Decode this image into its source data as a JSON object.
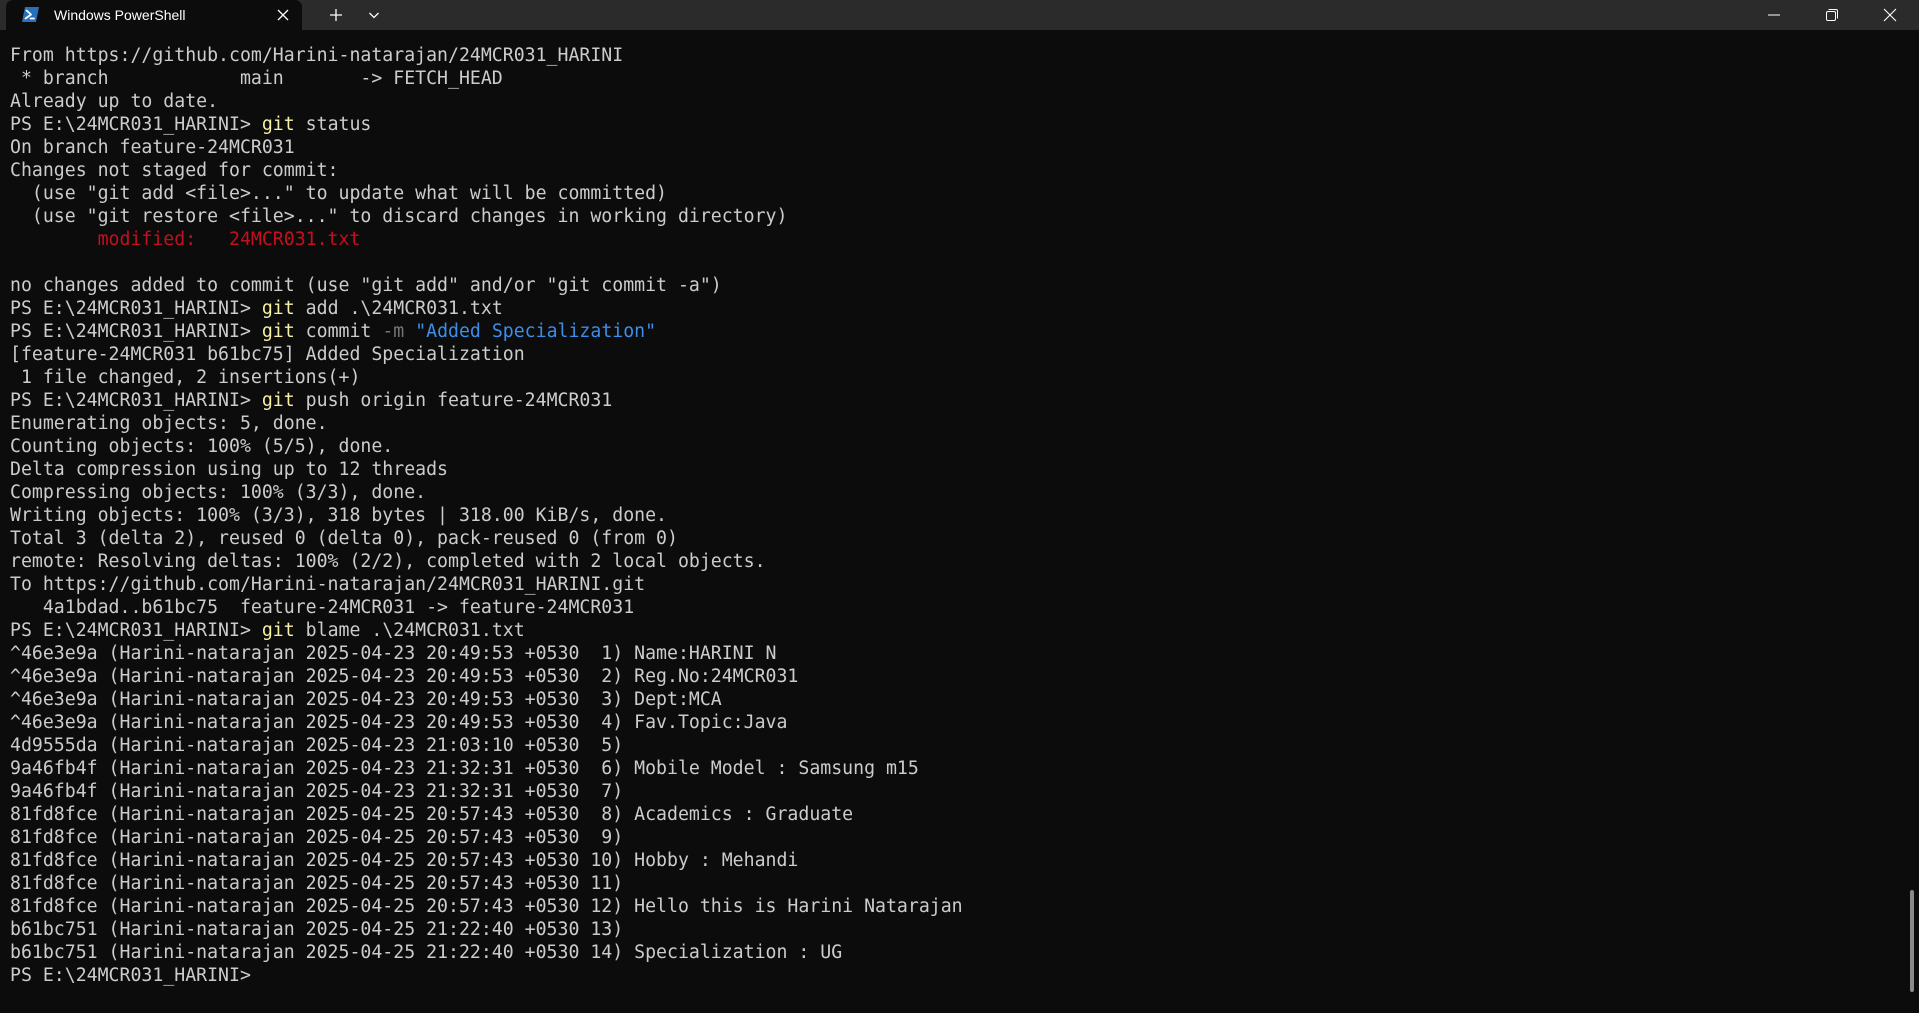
{
  "titlebar": {
    "tab_title": "Windows PowerShell",
    "tab_icon": "powershell-icon",
    "close_tab_icon": "close-icon",
    "new_tab_icon": "plus-icon",
    "dropdown_icon": "chevron-down-icon",
    "window_controls": [
      "minimize-icon",
      "restore-icon",
      "close-icon"
    ]
  },
  "colors": {
    "background": "#0c0c0c",
    "titlebar": "#2b2b2b",
    "text": "#cccccc",
    "command": "#f9f1a5",
    "parameter": "#767676",
    "string": "#3b8eea",
    "modified": "#c50f1f"
  },
  "terminal": {
    "lines": [
      [
        {
          "t": "From https://github.com/Harini-natarajan/24MCR031_HARINI"
        }
      ],
      [
        {
          "t": " * branch            main       -> FETCH_HEAD"
        }
      ],
      [
        {
          "t": "Already up to date."
        }
      ],
      [
        {
          "t": "PS E:\\24MCR031_HARINI> "
        },
        {
          "t": "git",
          "c": "cmd"
        },
        {
          "t": " status"
        }
      ],
      [
        {
          "t": "On branch feature-24MCR031"
        }
      ],
      [
        {
          "t": "Changes not staged for commit:"
        }
      ],
      [
        {
          "t": "  (use \"git add <file>...\" to update what will be committed)"
        }
      ],
      [
        {
          "t": "  (use \"git restore <file>...\" to discard changes in working directory)"
        }
      ],
      [
        {
          "t": "        modified:   24MCR031.txt",
          "c": "err"
        }
      ],
      [
        {
          "t": ""
        }
      ],
      [
        {
          "t": "no changes added to commit (use \"git add\" and/or \"git commit -a\")"
        }
      ],
      [
        {
          "t": "PS E:\\24MCR031_HARINI> "
        },
        {
          "t": "git",
          "c": "cmd"
        },
        {
          "t": " add .\\24MCR031.txt"
        }
      ],
      [
        {
          "t": "PS E:\\24MCR031_HARINI> "
        },
        {
          "t": "git",
          "c": "cmd"
        },
        {
          "t": " commit "
        },
        {
          "t": "-m",
          "c": "param"
        },
        {
          "t": " "
        },
        {
          "t": "\"Added Specialization\"",
          "c": "str"
        }
      ],
      [
        {
          "t": "[feature-24MCR031 b61bc75] Added Specialization"
        }
      ],
      [
        {
          "t": " 1 file changed, 2 insertions(+)"
        }
      ],
      [
        {
          "t": "PS E:\\24MCR031_HARINI> "
        },
        {
          "t": "git",
          "c": "cmd"
        },
        {
          "t": " push origin feature-24MCR031"
        }
      ],
      [
        {
          "t": "Enumerating objects: 5, done."
        }
      ],
      [
        {
          "t": "Counting objects: 100% (5/5), done."
        }
      ],
      [
        {
          "t": "Delta compression using up to 12 threads"
        }
      ],
      [
        {
          "t": "Compressing objects: 100% (3/3), done."
        }
      ],
      [
        {
          "t": "Writing objects: 100% (3/3), 318 bytes | 318.00 KiB/s, done."
        }
      ],
      [
        {
          "t": "Total 3 (delta 2), reused 0 (delta 0), pack-reused 0 (from 0)"
        }
      ],
      [
        {
          "t": "remote: Resolving deltas: 100% (2/2), completed with 2 local objects."
        }
      ],
      [
        {
          "t": "To https://github.com/Harini-natarajan/24MCR031_HARINI.git"
        }
      ],
      [
        {
          "t": "   4a1bdad..b61bc75  feature-24MCR031 -> feature-24MCR031"
        }
      ],
      [
        {
          "t": "PS E:\\24MCR031_HARINI> "
        },
        {
          "t": "git",
          "c": "cmd"
        },
        {
          "t": " blame .\\24MCR031.txt"
        }
      ],
      [
        {
          "t": "^46e3e9a (Harini-natarajan 2025-04-23 20:49:53 +0530  1) Name:HARINI N"
        }
      ],
      [
        {
          "t": "^46e3e9a (Harini-natarajan 2025-04-23 20:49:53 +0530  2) Reg.No:24MCR031"
        }
      ],
      [
        {
          "t": "^46e3e9a (Harini-natarajan 2025-04-23 20:49:53 +0530  3) Dept:MCA"
        }
      ],
      [
        {
          "t": "^46e3e9a (Harini-natarajan 2025-04-23 20:49:53 +0530  4) Fav.Topic:Java"
        }
      ],
      [
        {
          "t": "4d9555da (Harini-natarajan 2025-04-23 21:03:10 +0530  5)"
        }
      ],
      [
        {
          "t": "9a46fb4f (Harini-natarajan 2025-04-23 21:32:31 +0530  6) Mobile Model : Samsung m15"
        }
      ],
      [
        {
          "t": "9a46fb4f (Harini-natarajan 2025-04-23 21:32:31 +0530  7)"
        }
      ],
      [
        {
          "t": "81fd8fce (Harini-natarajan 2025-04-25 20:57:43 +0530  8) Academics : Graduate"
        }
      ],
      [
        {
          "t": "81fd8fce (Harini-natarajan 2025-04-25 20:57:43 +0530  9)"
        }
      ],
      [
        {
          "t": "81fd8fce (Harini-natarajan 2025-04-25 20:57:43 +0530 10) Hobby : Mehandi"
        }
      ],
      [
        {
          "t": "81fd8fce (Harini-natarajan 2025-04-25 20:57:43 +0530 11)"
        }
      ],
      [
        {
          "t": "81fd8fce (Harini-natarajan 2025-04-25 20:57:43 +0530 12) Hello this is Harini Natarajan"
        }
      ],
      [
        {
          "t": "b61bc751 (Harini-natarajan 2025-04-25 21:22:40 +0530 13)"
        }
      ],
      [
        {
          "t": "b61bc751 (Harini-natarajan 2025-04-25 21:22:40 +0530 14) Specialization : UG"
        }
      ],
      [
        {
          "t": "PS E:\\24MCR031_HARINI> "
        }
      ]
    ]
  }
}
